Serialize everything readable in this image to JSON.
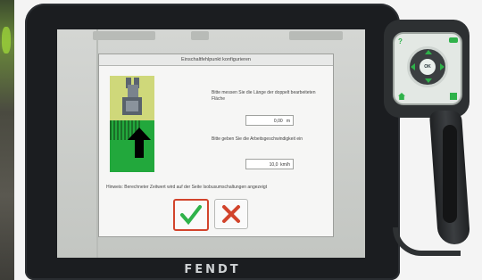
{
  "terminal": {
    "brand": "FENDT"
  },
  "dialog": {
    "title": "Einschaltfehlpunkt konfigurieren",
    "prompt_length": "Bitte messen Sie die Länge der doppelt bearbeiteten Fläche",
    "length_value": "0,00",
    "length_unit": "m",
    "prompt_speed": "Bitte geben Sie die Arbeitsgeschwindigkeit ein",
    "speed_value": "10,0",
    "speed_unit": "km/h",
    "hint": "Hinweis: Berechneter Zeitwert wird auf der Seite Isobusumschaltungen angezeigt",
    "confirm_icon": "checkmark-icon",
    "cancel_icon": "x-icon"
  },
  "joystick": {
    "center_label": "OK",
    "buttons": [
      "help-button",
      "up-arrow",
      "down-arrow",
      "left-arrow",
      "right-arrow",
      "home-button",
      "back-button"
    ]
  },
  "colors": {
    "accent_green": "#22a83c",
    "confirm_border": "#d2442c",
    "check_color": "#2fb24a",
    "cancel_color": "#d2442c"
  }
}
